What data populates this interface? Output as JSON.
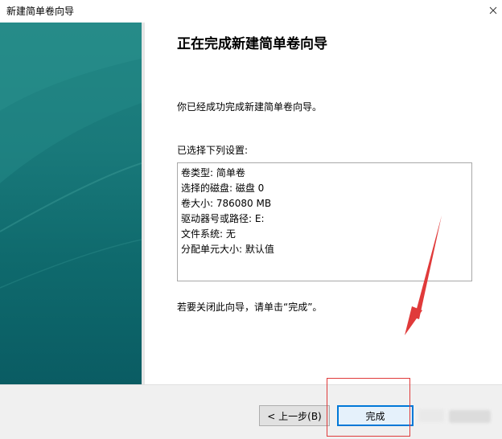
{
  "window": {
    "title": "新建简单卷向导"
  },
  "main": {
    "heading": "正在完成新建简单卷向导",
    "intro": "你已经成功完成新建简单卷向导。",
    "settings_label": "已选择下列设置:",
    "settings": [
      "卷类型: 简单卷",
      "选择的磁盘: 磁盘 0",
      "卷大小: 786080 MB",
      "驱动器号或路径: E:",
      "文件系统: 无",
      "分配单元大小: 默认值"
    ],
    "close_hint": "若要关闭此向导，请单击“完成”。"
  },
  "buttons": {
    "back": "< 上一步(B)",
    "finish": "完成"
  },
  "colors": {
    "sidebar": "#19797a",
    "annotation": "#e03a3a",
    "focus": "#0078d7"
  },
  "icons": {
    "close": "close-icon"
  }
}
